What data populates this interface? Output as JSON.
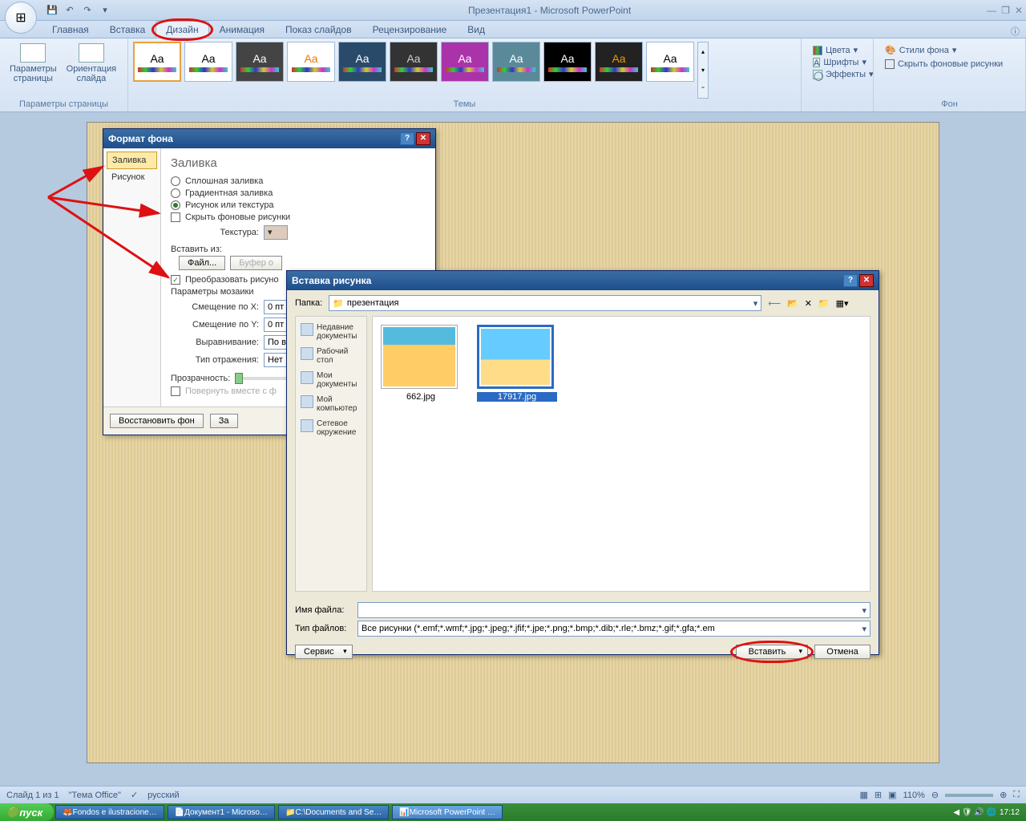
{
  "title": "Презентация1 - Microsoft PowerPoint",
  "tabs": [
    "Главная",
    "Вставка",
    "Дизайн",
    "Анимация",
    "Показ слайдов",
    "Рецензирование",
    "Вид"
  ],
  "active_tab": 2,
  "ribbon": {
    "page_setup_label": "Параметры страницы",
    "page_params": "Параметры\nстраницы",
    "orientation": "Ориентация\nслайда",
    "themes_label": "Темы",
    "colors": "Цвета",
    "fonts": "Шрифты",
    "effects": "Эффекты",
    "bg_styles": "Стили фона",
    "hide_bg": "Скрыть фоновые рисунки",
    "bg_label": "Фон"
  },
  "format_dialog": {
    "title": "Формат фона",
    "nav_fill": "Заливка",
    "nav_picture": "Рисунок",
    "heading": "Заливка",
    "opt_solid": "Сплошная заливка",
    "opt_gradient": "Градиентная заливка",
    "opt_picture": "Рисунок или текстура",
    "chk_hide": "Скрыть фоновые рисунки",
    "texture_label": "Текстура:",
    "insert_from": "Вставить из:",
    "file_btn": "Файл...",
    "clipboard_btn": "Буфер о",
    "chk_tile": "Преобразовать рисуно",
    "mosaic_params": "Параметры мозаики",
    "offset_x_label": "Смещение по X:",
    "offset_x_val": "0 пт",
    "offset_y_label": "Смещение по Y:",
    "offset_y_val": "0 пт",
    "align_label": "Выравнивание:",
    "align_val": "По вер",
    "mirror_label": "Тип отражения:",
    "mirror_val": "Нет",
    "transparency": "Прозрачность:",
    "rotate": "Повернуть вместе с ф",
    "restore_btn": "Восстановить фон",
    "apply_btn": "За"
  },
  "insert_dialog": {
    "title": "Вставка рисунка",
    "folder_label": "Папка:",
    "folder_val": "презентация",
    "places": [
      "Недавние документы",
      "Рабочий стол",
      "Мои документы",
      "Мой компьютер",
      "Сетевое окружение"
    ],
    "files": [
      {
        "name": "662.jpg",
        "selected": false
      },
      {
        "name": "17917.jpg",
        "selected": true
      }
    ],
    "filename_label": "Имя файла:",
    "filename_val": "",
    "filetype_label": "Тип файлов:",
    "filetype_val": "Все рисунки (*.emf;*.wmf;*.jpg;*.jpeg;*.jfif;*.jpe;*.png;*.bmp;*.dib;*.rle;*.bmz;*.gif;*.gfa;*.em",
    "service_btn": "Сервис",
    "insert_btn": "Вставить",
    "cancel_btn": "Отмена"
  },
  "statusbar": {
    "slide": "Слайд 1 из 1",
    "theme": "\"Тема Office\"",
    "lang": "русский",
    "zoom": "110%"
  },
  "taskbar": {
    "start": "пуск",
    "tasks": [
      "Fondos e ilustracione…",
      "Документ1 - Microso…",
      "C:\\Documents and Se…",
      "Microsoft PowerPoint …"
    ],
    "time": "17:12"
  }
}
